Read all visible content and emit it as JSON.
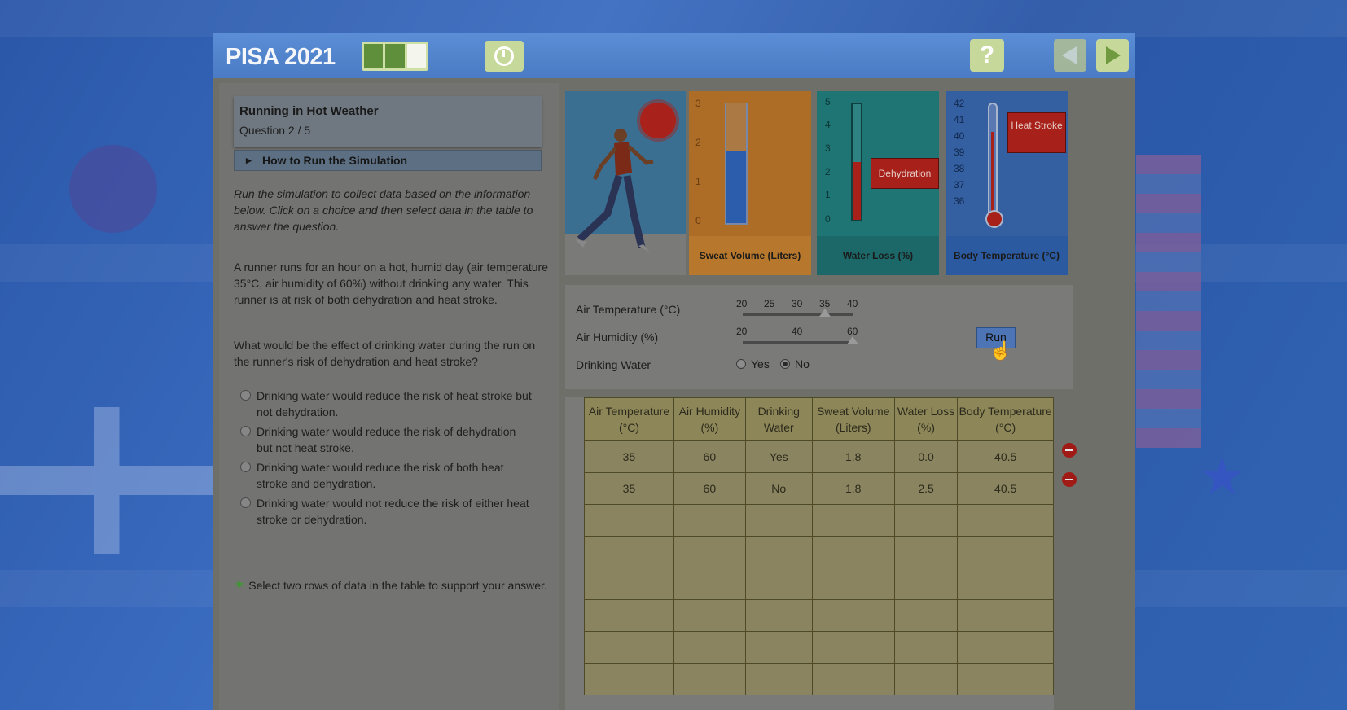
{
  "app": {
    "brand": "PISA 2021",
    "progress": {
      "current": 3,
      "total": 3
    }
  },
  "header": {
    "help_label": "?"
  },
  "question": {
    "title": "Running in Hot Weather",
    "number": "Question 2 / 5",
    "howto": "How to Run the Simulation",
    "instructions": "Run the simulation to collect data based on the information below. Click on a choice and then select data in the table to answer the question.",
    "scenario": "A runner runs for an hour on a hot, humid day (air temperature 35°C, air humidity of 60%) without drinking any water. This runner is at risk of both dehydration and heat stroke.",
    "prompt": "What would be the effect of drinking water during the run on the runner's risk of dehydration and heat stroke?",
    "choices": [
      "Drinking water would reduce the risk of heat stroke but not dehydration.",
      "Drinking water would reduce the risk of dehydration but not heat stroke.",
      "Drinking water would reduce the risk of both heat stroke and dehydration.",
      "Drinking water would not reduce the risk of either heat stroke or dehydration."
    ],
    "hint": "Select two rows of data in the table to support your answer."
  },
  "gauges": {
    "sweat": {
      "label": "Sweat Volume (Liters)",
      "ticks": [
        "3",
        "2",
        "1",
        "0"
      ],
      "value": 1.8,
      "max": 3
    },
    "water": {
      "label": "Water Loss (%)",
      "ticks": [
        "5",
        "4",
        "3",
        "2",
        "1",
        "0"
      ],
      "value": 2.5,
      "max": 5,
      "tag": "Dehydration"
    },
    "temp": {
      "label": "Body Temperature (°C)",
      "ticks": [
        "42",
        "41",
        "40",
        "39",
        "38",
        "37",
        "36"
      ],
      "value": 40.5,
      "tag": "Heat Stroke"
    }
  },
  "controls": {
    "air_temp": {
      "label": "Air Temperature (°C)",
      "scale": [
        "20",
        "25",
        "30",
        "35",
        "40"
      ],
      "value": "35"
    },
    "air_humidity": {
      "label": "Air Humidity (%)",
      "scale": [
        "20",
        "40",
        "60"
      ],
      "value": "60"
    },
    "drinking_water": {
      "label": "Drinking Water",
      "yes": "Yes",
      "no": "No",
      "selected": "No"
    },
    "run_label": "Run"
  },
  "table": {
    "headers": [
      "Air Temperature (°C)",
      "Air Humidity (%)",
      "Drinking Water",
      "Sweat Volume (Liters)",
      "Water Loss (%)",
      "Body Temperature (°C)"
    ],
    "rows": [
      [
        "35",
        "60",
        "Yes",
        "1.8",
        "0.0",
        "40.5"
      ],
      [
        "35",
        "60",
        "No",
        "1.8",
        "2.5",
        "40.5"
      ],
      [
        "",
        "",
        "",
        "",
        "",
        ""
      ],
      [
        "",
        "",
        "",
        "",
        "",
        ""
      ],
      [
        "",
        "",
        "",
        "",
        "",
        ""
      ],
      [
        "",
        "",
        "",
        "",
        "",
        ""
      ],
      [
        "",
        "",
        "",
        "",
        "",
        ""
      ],
      [
        "",
        "",
        "",
        "",
        "",
        ""
      ]
    ]
  },
  "colors": {
    "brand_bar": "#5b8ed6",
    "alert_red": "#a7211a",
    "sweat_panel": "#ad6d26",
    "water_panel": "#1f7474",
    "temp_panel": "#3460a2"
  }
}
